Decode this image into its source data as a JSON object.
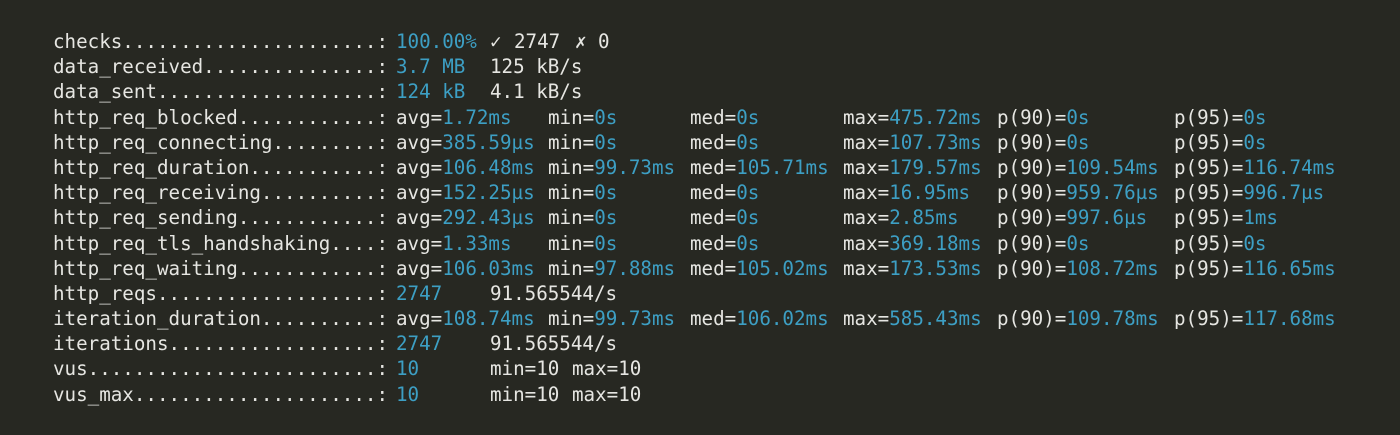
{
  "colors": {
    "background": "#272822",
    "text": "#e6e6e2",
    "value": "#3d9fc4"
  },
  "metrics": {
    "checks": {
      "name": "checks......................:",
      "rate": "100.00%",
      "pass_icon": "✓",
      "passes": "2747",
      "fail_icon": "✗",
      "fails": "0"
    },
    "data_received": {
      "name": "data_received...............:",
      "total": "3.7 MB",
      "rate": "125 kB/s"
    },
    "data_sent": {
      "name": "data_sent...................:",
      "total": "124 kB",
      "rate": "4.1 kB/s"
    },
    "http_req_blocked": {
      "name": "http_req_blocked............:",
      "avg": "1.72ms",
      "min": "0s",
      "med": "0s",
      "max": "475.72ms",
      "p90": "0s",
      "p95": "0s"
    },
    "http_req_connecting": {
      "name": "http_req_connecting.........:",
      "avg": "385.59µs",
      "min": "0s",
      "med": "0s",
      "max": "107.73ms",
      "p90": "0s",
      "p95": "0s"
    },
    "http_req_duration": {
      "name": "http_req_duration...........:",
      "avg": "106.48ms",
      "min": "99.73ms",
      "med": "105.71ms",
      "max": "179.57ms",
      "p90": "109.54ms",
      "p95": "116.74ms"
    },
    "http_req_receiving": {
      "name": "http_req_receiving..........:",
      "avg": "152.25µs",
      "min": "0s",
      "med": "0s",
      "max": "16.95ms",
      "p90": "959.76µs",
      "p95": "996.7µs"
    },
    "http_req_sending": {
      "name": "http_req_sending............:",
      "avg": "292.43µs",
      "min": "0s",
      "med": "0s",
      "max": "2.85ms",
      "p90": "997.6µs",
      "p95": "1ms"
    },
    "http_req_tls_handshaking": {
      "name": "http_req_tls_handshaking....:",
      "avg": "1.33ms",
      "min": "0s",
      "med": "0s",
      "max": "369.18ms",
      "p90": "0s",
      "p95": "0s"
    },
    "http_req_waiting": {
      "name": "http_req_waiting............:",
      "avg": "106.03ms",
      "min": "97.88ms",
      "med": "105.02ms",
      "max": "173.53ms",
      "p90": "108.72ms",
      "p95": "116.65ms"
    },
    "http_reqs": {
      "name": "http_reqs...................:",
      "count": "2747",
      "rate": "91.565544/s"
    },
    "iteration_duration": {
      "name": "iteration_duration..........:",
      "avg": "108.74ms",
      "min": "99.73ms",
      "med": "106.02ms",
      "max": "585.43ms",
      "p90": "109.78ms",
      "p95": "117.68ms"
    },
    "iterations": {
      "name": "iterations..................:",
      "count": "2747",
      "rate": "91.565544/s"
    },
    "vus": {
      "name": "vus.........................:",
      "value": "10",
      "min": "10",
      "max": "10"
    },
    "vus_max": {
      "name": "vus_max.....................:",
      "value": "10",
      "min": "10",
      "max": "10"
    }
  }
}
